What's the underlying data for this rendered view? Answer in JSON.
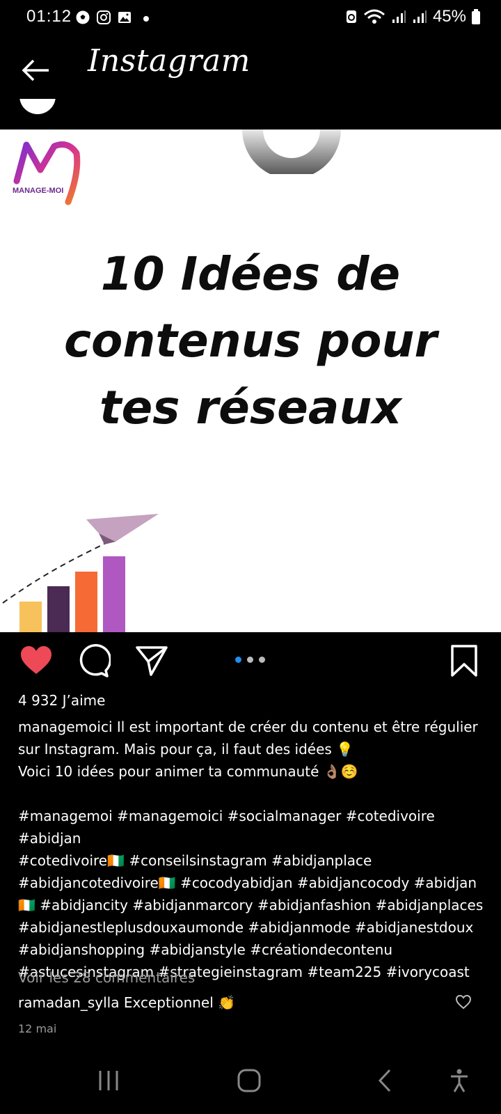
{
  "status_bar": {
    "time": "01:12",
    "battery": "45%"
  },
  "header": {
    "title": "Instagram"
  },
  "post": {
    "image": {
      "headline_lines": [
        "10 Idées de",
        "contenus pour",
        "tes réseaux"
      ],
      "brand_name": "MANAGE-MOI",
      "bar_colors": [
        "#f7c15c",
        "#4b2a54",
        "#f56a35",
        "#b058c2"
      ]
    },
    "likes": "4 932 J’aime",
    "caption": {
      "lines": [
        "managemoici Il est important de créer du contenu et être régulier",
        "sur Instagram. Mais pour ça, il faut des idées 💡",
        "Voici 10 idées pour animer ta communauté 👌🏽☺️"
      ]
    },
    "hashtags": [
      "#managemoi #managemoici #socialmanager #cotedivoire #abidjan",
      "#cotedivoire🇨🇮 #conseilsinstagram #abidjanplace",
      "#abidjancotedivoire🇨🇮 #cocodyabidjan #abidjancocody #abidjan",
      "🇨🇮 #abidjancity #abidjanmarcory #abidjanfashion #abidjanplaces",
      "#abidjanestleplusdouxaumonde #abidjanmode #abidjanestdoux",
      "#abidjanshopping #abidjanstyle #créationdecontenu",
      "#astucesinstagram #strategieinstagram #team225 #ivorycoast"
    ],
    "view_comments": "Voir les 28 commentaires",
    "comment": {
      "user": "ramadan_sylla",
      "text": "Exceptionnel 👏"
    },
    "date": "12 mai"
  },
  "colors": {
    "like_active": "#ed4956",
    "carousel_active_dot": "#1f8ef1"
  }
}
